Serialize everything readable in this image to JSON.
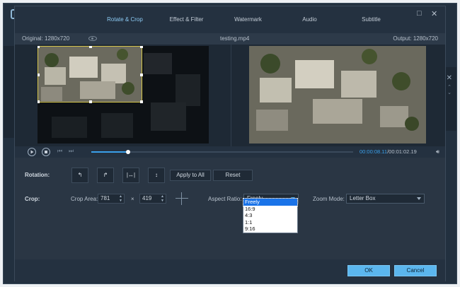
{
  "tabs": [
    {
      "label": "Rotate & Crop"
    },
    {
      "label": "Effect & Filter"
    },
    {
      "label": "Watermark"
    },
    {
      "label": "Audio"
    },
    {
      "label": "Subtitle"
    }
  ],
  "active_tab": "Rotate & Crop",
  "info": {
    "original": "Original: 1280x720",
    "filename": "testing.mp4",
    "output": "Output: 1280x720"
  },
  "playback": {
    "current_time": "00:00:08.11",
    "total_time": "/00:01:02.19",
    "progress": 0.14
  },
  "rotation": {
    "label": "Rotation:",
    "buttons": [
      {
        "icon": "rotate-left-icon",
        "glyph": "↰"
      },
      {
        "icon": "rotate-right-icon",
        "glyph": "↱"
      },
      {
        "icon": "flip-horizontal-icon",
        "glyph": "|↔|"
      },
      {
        "icon": "flip-vertical-icon",
        "glyph": "↕"
      }
    ],
    "apply_all": "Apply to All",
    "reset": "Reset"
  },
  "crop": {
    "label": "Crop:",
    "area_label": "Crop Area:",
    "width": "781",
    "times": "×",
    "height": "419",
    "aspect_label": "Aspect Ratio:",
    "aspect_value": "Freely",
    "zoom_label": "Zoom Mode:",
    "zoom_value": "Letter Box"
  },
  "aspect_options": [
    "Freely",
    "16:9",
    "4:3",
    "1:1",
    "9:16"
  ],
  "footer": {
    "ok": "OK",
    "cancel": "Cancel"
  },
  "colors": {
    "accent": "#3aa0ea",
    "crop_border": "#d4c44a",
    "button_blue": "#5bb6ee"
  }
}
